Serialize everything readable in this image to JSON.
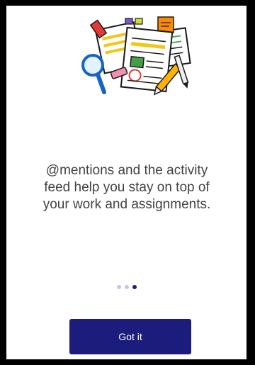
{
  "onboarding": {
    "message": "@mentions and the activity feed help you stay on top of your work and assignments.",
    "illustration_icon": "documents-magnifier-pen-illustration",
    "pager": {
      "total": 3,
      "active_index": 2
    },
    "got_it_label": "Got it"
  },
  "colors": {
    "accent": "#1B1C7C",
    "dot_inactive": "#C5C8E8",
    "text": "#424242"
  }
}
